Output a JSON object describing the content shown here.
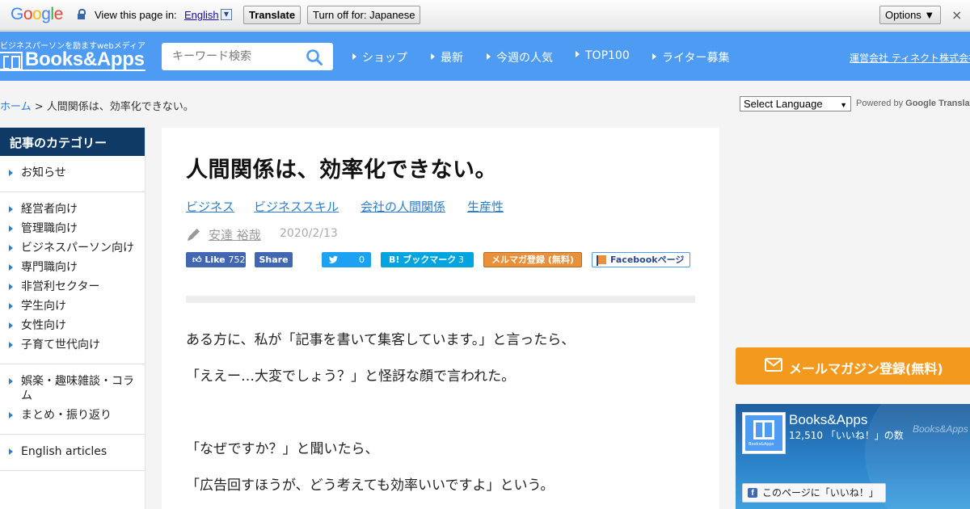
{
  "translate_bar": {
    "logo_letters": [
      "G",
      "o",
      "o",
      "g",
      "l",
      "e"
    ],
    "view_text": "View this page in:",
    "language": "English",
    "translate_label": "Translate",
    "turnoff_label": "Turn off for: Japanese",
    "options_label": "Options ▼",
    "close_glyph": "×"
  },
  "header": {
    "tagline": "ビジネスパーソンを励ますwebメディア",
    "logo_text": "Books&Apps",
    "search_placeholder": "キーワード検索",
    "nav": [
      "ショップ",
      "最新",
      "今週の人気",
      "TOP100",
      "ライター募集"
    ],
    "company_link": "運営会社 ティネクト株式会社"
  },
  "breadcrumb": {
    "home": "ホーム",
    "separator": " > ",
    "current": "人間関係は、効率化できない。"
  },
  "language_selector": {
    "label": "Select Language",
    "powered_prefix": "Powered by ",
    "powered_brand": "Google",
    "powered_suffix": " Translate"
  },
  "sidebar": {
    "title": "記事のカテゴリー",
    "groups": [
      [
        "お知らせ"
      ],
      [
        "経営者向け",
        "管理職向け",
        "ビジネスパーソン向け",
        "専門職向け",
        "非営利セクター",
        "学生向け",
        "女性向け",
        "子育て世代向け"
      ],
      [
        "娯楽・趣味雑談・コラム",
        "まとめ・振り返り"
      ],
      [
        "English articles"
      ]
    ]
  },
  "article": {
    "title": "人間関係は、効率化できない。",
    "tags": [
      "ビジネス",
      "ビジネススキル",
      "会社の人間関係",
      "生産性"
    ],
    "author": "安達 裕哉",
    "date": "2020/2/13",
    "share": {
      "fb_like_label": "Like",
      "fb_like_count": "752",
      "fb_share_label": "Share",
      "tweet_count": "0",
      "hatena_label": "B! ブックマーク",
      "hatena_count": "3",
      "mailmag_label": "メルマガ登録 (無料)",
      "fb_page_label": "Facebookページ"
    },
    "paragraphs": [
      "ある方に、私が「記事を書いて集客しています。」と言ったら、",
      "「ええー…大変でしょう？」と怪訝な顔で言われた。",
      "「なぜですか？」と聞いたら、",
      "「広告回すほうが、どう考えても効率いいですよ」という。"
    ]
  },
  "right_column": {
    "mailmag_button": "メールマガジン登録(無料)",
    "fb_widget": {
      "page_name": "Books&Apps",
      "likes_text": "12,510 「いいね！」の数",
      "thumb_caption": "Books&Apps",
      "watermark": "Books&Apps",
      "like_button": "このページに「いいね！」"
    }
  },
  "colors": {
    "header_blue": "#4d9bf2",
    "sidebar_title_navy": "#0f3a66",
    "link_blue": "#2a7fd4",
    "mail_orange": "#f39a1e",
    "facebook_blue": "#4267b2",
    "twitter_blue": "#1da1f2",
    "hatena_blue": "#00a4de"
  }
}
